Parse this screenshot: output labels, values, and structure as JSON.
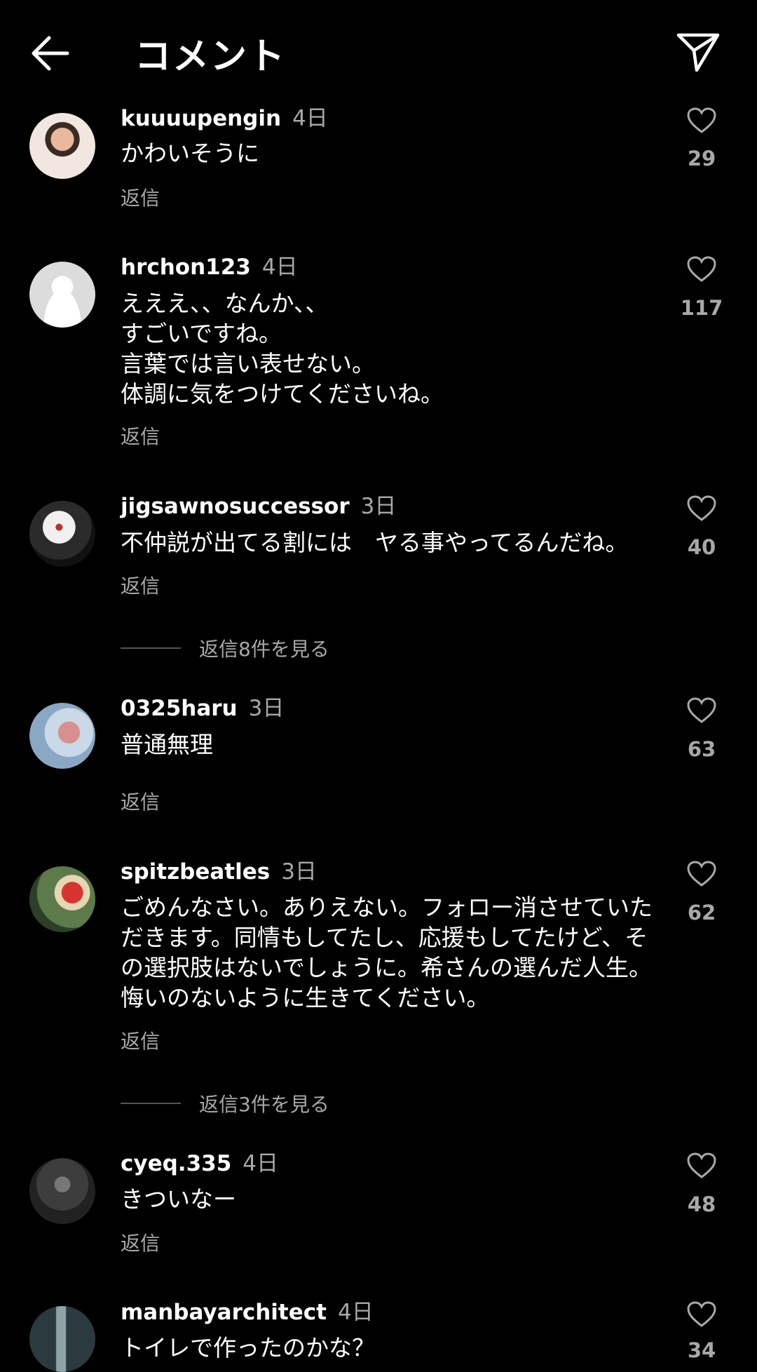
{
  "header": {
    "title": "コメント",
    "back_icon": "arrow-left-icon",
    "send_icon": "paper-plane-icon"
  },
  "comments": [
    {
      "username": "kuuuupengin",
      "time": "4日",
      "text": "かわいそうに",
      "likes": "29",
      "reply": "返信"
    },
    {
      "username": "hrchon123",
      "time": "4日",
      "text": "えええ、、なんか、、\nすごいですね。\n言葉では言い表せない。\n体調に気をつけてくださいね。",
      "likes": "117",
      "reply": "返信"
    },
    {
      "username": "jigsawnosuccessor",
      "time": "3日",
      "text": "不仲説が出てる割には　ヤる事やってるんだね。",
      "likes": "40",
      "reply": "返信",
      "view_replies": "返信8件を見る"
    },
    {
      "username": "0325haru",
      "time": "3日",
      "text": "普通無理",
      "likes": "63",
      "reply": "返信"
    },
    {
      "username": "spitzbeatles",
      "time": "3日",
      "text": "ごめんなさい。ありえない。フォロー消させていただきます。同情もしてたし、応援もしてたけど、その選択肢はないでしょうに。希さんの選んだ人生。悔いのないように生きてください。",
      "likes": "62",
      "reply": "返信",
      "view_replies": "返信3件を見る"
    },
    {
      "username": "cyeq.335",
      "time": "4日",
      "text": "きついなー",
      "likes": "48",
      "reply": "返信"
    },
    {
      "username": "manbayarchitect",
      "time": "4日",
      "text": "トイレで作ったのかな？",
      "likes": "34",
      "reply": ""
    }
  ]
}
